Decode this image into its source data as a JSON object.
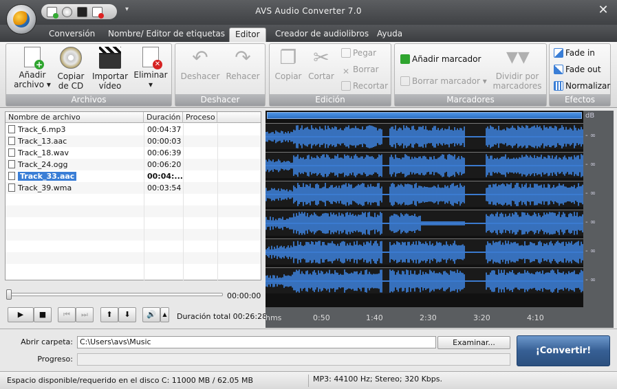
{
  "window": {
    "title": "AVS Audio Converter  7.0",
    "close": "✕",
    "qat_dropdown": "▾"
  },
  "tabs": [
    {
      "label": "Conversión",
      "active": false
    },
    {
      "label": "Nombre/ Editor de etiquetas",
      "active": false
    },
    {
      "label": "Editor",
      "active": true
    },
    {
      "label": "Creador de audiolibros",
      "active": false
    },
    {
      "label": "Ayuda",
      "active": false
    }
  ],
  "ribbon": {
    "archivos": {
      "title": "Archivos",
      "add": {
        "line1": "Añadir",
        "line2": "archivo ▾",
        "icon": "add-file-icon"
      },
      "copycd": {
        "line1": "Copiar",
        "line2": "de CD",
        "icon": "cd-icon"
      },
      "importvideo": {
        "line1": "Importar",
        "line2": "vídeo",
        "icon": "clapperboard-icon"
      },
      "delete": {
        "line1": "Eliminar",
        "line2": "▾",
        "icon": "delete-file-icon"
      }
    },
    "deshacer": {
      "title": "Deshacer",
      "undo": "Deshacer",
      "redo": "Rehacer"
    },
    "edicion": {
      "title": "Edición",
      "copy": "Copiar",
      "cut": "Cortar",
      "paste": "Pegar",
      "delete": "Borrar",
      "trim": "Recortar"
    },
    "marcadores": {
      "title": "Marcadores",
      "add": "Añadir marcador",
      "remove": "Borrar marcador  ▾",
      "split_line1": "Dividir por",
      "split_line2": "marcadores"
    },
    "efectos": {
      "title": "Efectos",
      "fadein": "Fade in",
      "fadeout": "Fade out",
      "normalize": "Normalizar"
    }
  },
  "files": {
    "headers": {
      "name": "Nombre de archivo",
      "duration": "Duración",
      "process": "Proceso"
    },
    "rows": [
      {
        "name": "Track_6.mp3",
        "duration": "00:04:37",
        "selected": false
      },
      {
        "name": "Track_13.aac",
        "duration": "00:00:03",
        "selected": false
      },
      {
        "name": "Track_18.wav",
        "duration": "00:06:39",
        "selected": false
      },
      {
        "name": "Track_24.ogg",
        "duration": "00:06:20",
        "selected": false
      },
      {
        "name": "Track_33.aac",
        "duration": "00:04:...",
        "selected": true
      },
      {
        "name": "Track_39.wma",
        "duration": "00:03:54",
        "selected": false
      }
    ]
  },
  "player": {
    "position": "00:00:00",
    "total_label": "Duración total",
    "total": "00:26:28",
    "seek_fraction": 0
  },
  "wave": {
    "db_label": "dB",
    "inf_label": "- ∞",
    "timeline": [
      "hms",
      "0:50",
      "1:40",
      "2:30",
      "3:20",
      "4:10"
    ],
    "channels": 6
  },
  "bottom": {
    "folder_label": "Abrir carpeta:",
    "folder_value": "C:\\Users\\avs\\Music",
    "browse": "Examinar...",
    "progress_label": "Progreso:",
    "convert": "¡Convertir!"
  },
  "status": {
    "disk": "Espacio disponible/requerido en el disco C: 11000 MB / 62.05 MB",
    "format": "MP3: 44100  Hz; Stereo; 320 Kbps."
  },
  "colors": {
    "wave": "#3f86e4",
    "selection": "#3a7ed6",
    "convert": "#365f94"
  }
}
